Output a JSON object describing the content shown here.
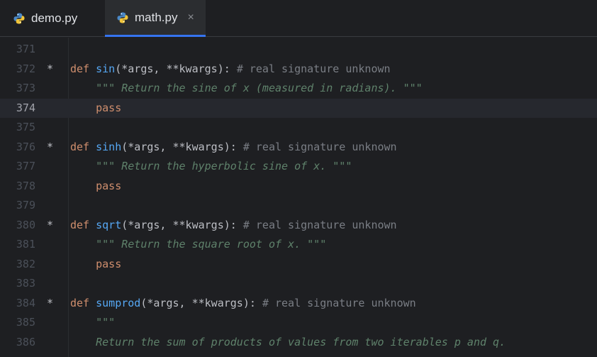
{
  "tabs": [
    {
      "label": "demo.py",
      "icon": "python-icon",
      "active": false
    },
    {
      "label": "math.py",
      "icon": "python-icon",
      "active": true,
      "close": "×"
    }
  ],
  "colors": {
    "accent": "#3574f0",
    "keyword": "#cf8e6d",
    "function": "#56a8f5",
    "comment": "#7a7e85",
    "docstring": "#5f826b"
  },
  "editor": {
    "current_line": 374,
    "lines": [
      {
        "num": "371",
        "mark": "",
        "kw": "",
        "fn": "",
        "rest": "",
        "comment": "",
        "doc": ""
      },
      {
        "num": "372",
        "mark": "*",
        "kw": "def",
        "fn": "sin",
        "rest": "(*args, **kwargs): ",
        "comment": "# real signature unknown",
        "doc": ""
      },
      {
        "num": "373",
        "mark": "",
        "kw": "",
        "fn": "",
        "rest": "",
        "comment": "",
        "doc": "\"\"\" Return the sine of x (measured in radians). \"\"\""
      },
      {
        "num": "374",
        "mark": "",
        "kw": "pass",
        "fn": "",
        "rest": "",
        "comment": "",
        "doc": ""
      },
      {
        "num": "375",
        "mark": "",
        "kw": "",
        "fn": "",
        "rest": "",
        "comment": "",
        "doc": ""
      },
      {
        "num": "376",
        "mark": "*",
        "kw": "def",
        "fn": "sinh",
        "rest": "(*args, **kwargs): ",
        "comment": "# real signature unknown",
        "doc": ""
      },
      {
        "num": "377",
        "mark": "",
        "kw": "",
        "fn": "",
        "rest": "",
        "comment": "",
        "doc": "\"\"\" Return the hyperbolic sine of x. \"\"\""
      },
      {
        "num": "378",
        "mark": "",
        "kw": "pass",
        "fn": "",
        "rest": "",
        "comment": "",
        "doc": ""
      },
      {
        "num": "379",
        "mark": "",
        "kw": "",
        "fn": "",
        "rest": "",
        "comment": "",
        "doc": ""
      },
      {
        "num": "380",
        "mark": "*",
        "kw": "def",
        "fn": "sqrt",
        "rest": "(*args, **kwargs): ",
        "comment": "# real signature unknown",
        "doc": ""
      },
      {
        "num": "381",
        "mark": "",
        "kw": "",
        "fn": "",
        "rest": "",
        "comment": "",
        "doc": "\"\"\" Return the square root of x. \"\"\""
      },
      {
        "num": "382",
        "mark": "",
        "kw": "pass",
        "fn": "",
        "rest": "",
        "comment": "",
        "doc": ""
      },
      {
        "num": "383",
        "mark": "",
        "kw": "",
        "fn": "",
        "rest": "",
        "comment": "",
        "doc": ""
      },
      {
        "num": "384",
        "mark": "*",
        "kw": "def",
        "fn": "sumprod",
        "rest": "(*args, **kwargs): ",
        "comment": "# real signature unknown",
        "doc": ""
      },
      {
        "num": "385",
        "mark": "",
        "kw": "",
        "fn": "",
        "rest": "",
        "comment": "",
        "doc": "\"\"\""
      },
      {
        "num": "386",
        "mark": "",
        "kw": "",
        "fn": "",
        "rest": "",
        "comment": "",
        "doc": "Return the sum of products of values from two iterables p and q."
      }
    ]
  }
}
